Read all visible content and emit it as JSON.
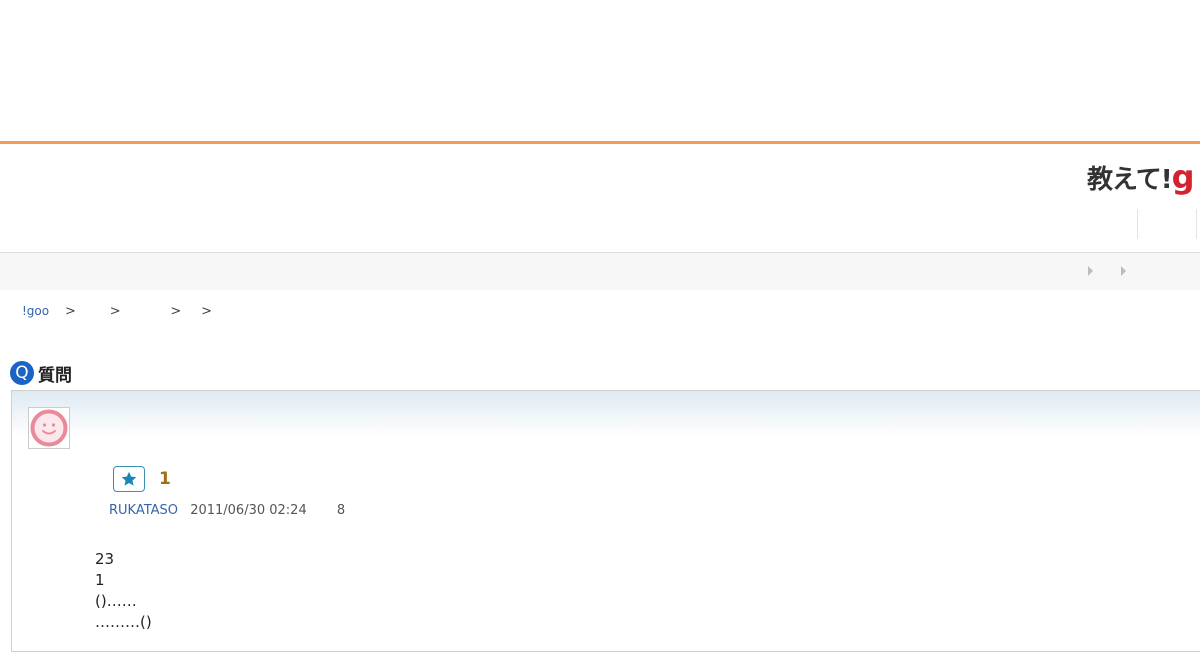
{
  "site": {
    "logo_text": "教えて!",
    "logo_g": "g"
  },
  "breadcrumb": {
    "home": "!goo",
    "separator": ">"
  },
  "question": {
    "heading_badge": "Q",
    "heading_title": "質問",
    "favorite_count": "1",
    "author": "RUKATASO",
    "date": "2011/06/30 02:24",
    "view_count": "8",
    "body_lines": [
      "23",
      "1",
      "()……",
      "………()"
    ]
  },
  "icons": {
    "favorite": "star-icon",
    "avatar": "smiley-avatar-icon",
    "subnav": "triangle-right-icon"
  },
  "colors": {
    "accent_orange": "#f39a55",
    "link_blue": "#3366aa",
    "q_badge_blue": "#1b63c4",
    "logo_red": "#d3232f",
    "favorite_count_brown": "#a26e0f",
    "avatar_pink": "#e98a9a"
  }
}
